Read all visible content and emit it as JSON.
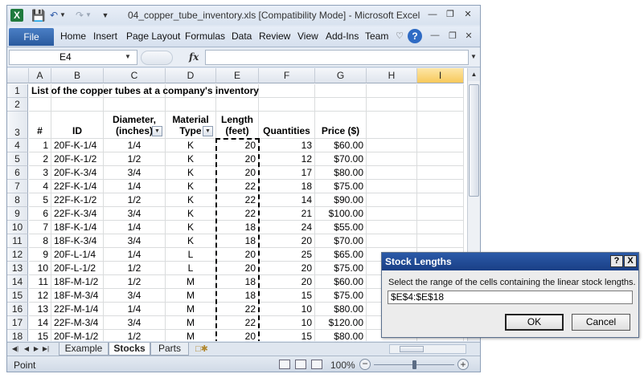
{
  "window": {
    "title": "04_copper_tube_inventory.xls  [Compatibility Mode]  -  Microsoft Excel",
    "app_icon": "X",
    "quick_access_icons": [
      "save-icon",
      "undo-icon",
      "redo-icon",
      "customize-icon"
    ]
  },
  "ribbon": {
    "file_tab": "File",
    "tabs": [
      "Home",
      "Insert",
      "Page Layout",
      "Formulas",
      "Data",
      "Review",
      "View",
      "Add-Ins",
      "Team"
    ],
    "help_icon": "?"
  },
  "formula_bar": {
    "name_box": "E4",
    "fx": "fx",
    "value": ""
  },
  "sheet": {
    "columns": [
      "A",
      "B",
      "C",
      "D",
      "E",
      "F",
      "G",
      "H",
      "I"
    ],
    "selected_column": "I",
    "row_numbers": [
      "1",
      "2",
      "3",
      "4",
      "5",
      "6",
      "7",
      "8",
      "9",
      "10",
      "11",
      "12",
      "13",
      "14",
      "15",
      "16",
      "17",
      "18"
    ],
    "title": "List of the copper tubes at a company's inventory",
    "headers": {
      "num": "#",
      "id": "ID",
      "diameter_1": "Diameter,",
      "diameter_2": "(inches)",
      "material_1": "Material",
      "material_2": "Type",
      "length_1": "Length",
      "length_2": "(feet)",
      "quantities": "Quantities",
      "price": "Price ($)"
    },
    "rows": [
      {
        "num": "1",
        "id": "20F-K-1/4",
        "diameter": "1/4",
        "material": "K",
        "length": "20",
        "quantity": "13",
        "price": "$60.00"
      },
      {
        "num": "2",
        "id": "20F-K-1/2",
        "diameter": "1/2",
        "material": "K",
        "length": "20",
        "quantity": "12",
        "price": "$70.00"
      },
      {
        "num": "3",
        "id": "20F-K-3/4",
        "diameter": "3/4",
        "material": "K",
        "length": "20",
        "quantity": "17",
        "price": "$80.00"
      },
      {
        "num": "4",
        "id": "22F-K-1/4",
        "diameter": "1/4",
        "material": "K",
        "length": "22",
        "quantity": "18",
        "price": "$75.00"
      },
      {
        "num": "5",
        "id": "22F-K-1/2",
        "diameter": "1/2",
        "material": "K",
        "length": "22",
        "quantity": "14",
        "price": "$90.00"
      },
      {
        "num": "6",
        "id": "22F-K-3/4",
        "diameter": "3/4",
        "material": "K",
        "length": "22",
        "quantity": "21",
        "price": "$100.00"
      },
      {
        "num": "7",
        "id": "18F-K-1/4",
        "diameter": "1/4",
        "material": "K",
        "length": "18",
        "quantity": "24",
        "price": "$55.00"
      },
      {
        "num": "8",
        "id": "18F-K-3/4",
        "diameter": "3/4",
        "material": "K",
        "length": "18",
        "quantity": "20",
        "price": "$70.00"
      },
      {
        "num": "9",
        "id": "20F-L-1/4",
        "diameter": "1/4",
        "material": "L",
        "length": "20",
        "quantity": "25",
        "price": "$65.00"
      },
      {
        "num": "10",
        "id": "20F-L-1/2",
        "diameter": "1/2",
        "material": "L",
        "length": "20",
        "quantity": "20",
        "price": "$75.00"
      },
      {
        "num": "11",
        "id": "18F-M-1/2",
        "diameter": "1/2",
        "material": "M",
        "length": "18",
        "quantity": "20",
        "price": "$60.00"
      },
      {
        "num": "12",
        "id": "18F-M-3/4",
        "diameter": "3/4",
        "material": "M",
        "length": "18",
        "quantity": "15",
        "price": "$75.00"
      },
      {
        "num": "13",
        "id": "22F-M-1/4",
        "diameter": "1/4",
        "material": "M",
        "length": "22",
        "quantity": "10",
        "price": "$80.00"
      },
      {
        "num": "14",
        "id": "22F-M-3/4",
        "diameter": "3/4",
        "material": "M",
        "length": "22",
        "quantity": "10",
        "price": "$120.00"
      },
      {
        "num": "15",
        "id": "20F-M-1/2",
        "diameter": "1/2",
        "material": "M",
        "length": "20",
        "quantity": "15",
        "price": "$80.00"
      }
    ]
  },
  "sheet_tabs": {
    "tabs": [
      "Example",
      "Stocks",
      "Parts"
    ],
    "active": "Stocks"
  },
  "status_bar": {
    "mode": "Point",
    "zoom": "100%",
    "zoom_fraction": 0.5
  },
  "dialog": {
    "title": "Stock Lengths",
    "help": "?",
    "close": "X",
    "prompt": "Select the range of the cells containing the linear stock lengths.",
    "input_value": "$E$4:$E$18",
    "ok_label": "OK",
    "cancel_label": "Cancel"
  },
  "colors": {
    "file_tab": "#2a5a9e",
    "dialog_title": "#1a3f86",
    "selected_column": "#f7c95c"
  }
}
